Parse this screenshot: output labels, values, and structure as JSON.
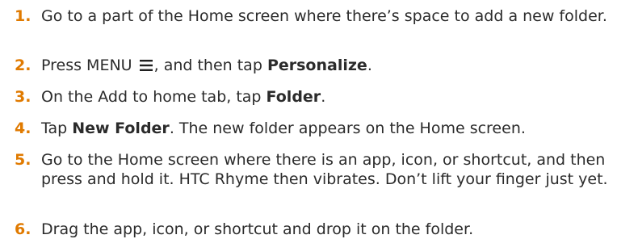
{
  "steps": [
    {
      "num": "1.",
      "text": "Go to a part of the Home screen where there’s space to add a new folder."
    },
    {
      "num": "2.",
      "pre": "Press MENU",
      "mid": ", and then tap",
      "bold": "Personalize",
      "post": ".",
      "icon": "menu-icon"
    },
    {
      "num": "3.",
      "pre": "On the Add to home tab, tap",
      "bold": "Folder",
      "post": "."
    },
    {
      "num": "4.",
      "pre": "Tap",
      "bold": "New Folder",
      "post": ". The new folder appears on the Home screen."
    },
    {
      "num": "5.",
      "text": "Go to the Home screen where there is an app, icon, or shortcut, and then press and hold it. HTC Rhyme then vibrates. Don’t lift your finger just yet."
    },
    {
      "num": "6.",
      "text": "Drag the app, icon, or shortcut and drop it on the folder."
    }
  ],
  "colors": {
    "number": "#e07a00",
    "text": "#2b2b2b"
  }
}
